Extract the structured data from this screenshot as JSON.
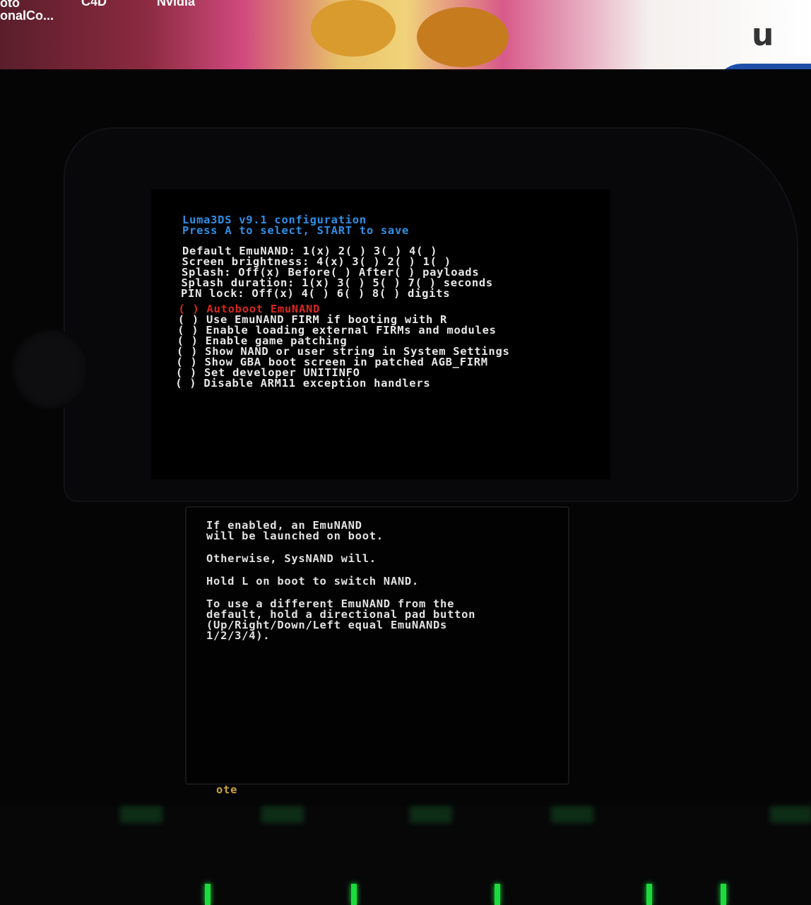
{
  "desktop": {
    "icon_labels": [
      "oto",
      "onalCo...",
      "C4D",
      "Nvidia"
    ],
    "logo_text": "u"
  },
  "top_screen": {
    "title": "Luma3DS v9.1 configuration",
    "instructions": "Press A to select, START to save",
    "multi_options": [
      {
        "label": "Default EmuNAND:",
        "choices": "1(x) 2( ) 3( ) 4( )"
      },
      {
        "label": "Screen brightness:",
        "choices": "4(x) 3( ) 2( ) 1( )"
      },
      {
        "label": "Splash:",
        "choices": "Off(x) Before( ) After( ) payloads"
      },
      {
        "label": "Splash duration:",
        "choices": "1(x) 3( ) 5( ) 7( ) seconds"
      },
      {
        "label": "PIN lock:",
        "choices": "Off(x) 4( ) 6( ) 8( ) digits"
      }
    ],
    "toggles": [
      {
        "mark": "( )",
        "label": "Autoboot EmuNAND",
        "selected": true
      },
      {
        "mark": "( )",
        "label": "Use EmuNAND FIRM if booting with R",
        "selected": false
      },
      {
        "mark": "( )",
        "label": "Enable loading external FIRMs and modules",
        "selected": false
      },
      {
        "mark": "( )",
        "label": "Enable game patching",
        "selected": false
      },
      {
        "mark": "( )",
        "label": "Show NAND or user string in System Settings",
        "selected": false
      },
      {
        "mark": "( )",
        "label": "Show GBA boot screen in patched AGB_FIRM",
        "selected": false
      },
      {
        "mark": "( )",
        "label": "Set developer UNITINFO",
        "selected": false
      },
      {
        "mark": "( )",
        "label": "Disable ARM11 exception handlers",
        "selected": false
      }
    ],
    "colors": {
      "header": "#2f8fe8",
      "selected": "#d6291e",
      "text": "#e8e8e8"
    }
  },
  "bottom_screen": {
    "paragraphs": [
      "If enabled, an EmuNAND\nwill be launched on boot.",
      "Otherwise, SysNAND will.",
      "Hold L on boot to switch NAND.",
      "To use a different EmuNAND from the\ndefault, hold a directional pad button\n(Up/Right/Down/Left equal EmuNANDs\n1/2/3/4)."
    ]
  },
  "keyboard": {
    "visible_key_text": "ote"
  }
}
